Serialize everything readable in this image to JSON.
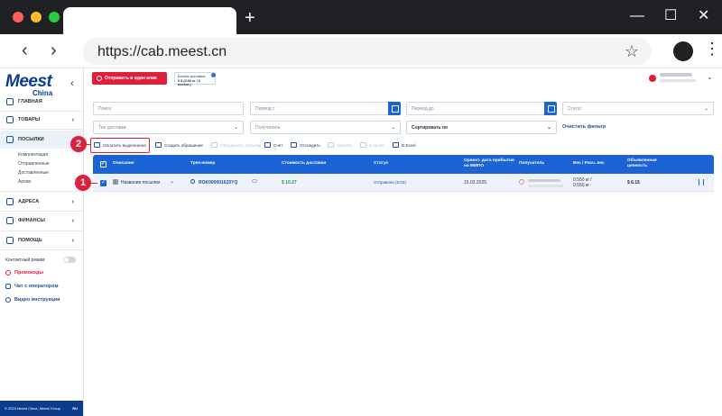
{
  "browser": {
    "url": "https://cab.meest.cn",
    "tab_plus": "+",
    "minimize": "—",
    "maximize": "☐",
    "close": "✕",
    "back": "‹",
    "forward": "›",
    "star": "☆",
    "menu": "⋮",
    "dot_colors": [
      "#ff5f57",
      "#febc2e",
      "#28c840"
    ]
  },
  "logo": {
    "brand": "Meest",
    "sub": "China"
  },
  "sidebar": {
    "collapse": "‹",
    "items": [
      {
        "label": "ГЛАВНАЯ",
        "icon": "home-icon",
        "chevron": ""
      },
      {
        "label": "ТОВАРЫ",
        "icon": "box-icon",
        "chevron": "›"
      },
      {
        "label": "ПОСЫЛКИ",
        "icon": "parcel-icon",
        "chevron": ""
      },
      {
        "label": "АДРЕСА",
        "icon": "location-icon",
        "chevron": "›"
      },
      {
        "label": "ФИНАНСЫ",
        "icon": "wallet-icon",
        "chevron": "›"
      },
      {
        "label": "ПОМОЩЬ",
        "icon": "help-icon",
        "chevron": "›"
      }
    ],
    "sub_items": [
      "Комплектация",
      "Отправленные",
      "Доставленные",
      "Архив"
    ],
    "contact_mode": "Контактный режим",
    "links": [
      {
        "label": "Промокоды",
        "color": "#e01f3d",
        "icon": "promo-icon"
      },
      {
        "label": "Чат с оператором",
        "color": "#1c4fa0",
        "icon": "chat-icon"
      },
      {
        "label": "Видео инструкции",
        "color": "#1c4fa0",
        "icon": "video-icon"
      }
    ],
    "footer": "© 2023 Meest China, Meest Group",
    "lang": "RU"
  },
  "header": {
    "send_button": "Отправить в один клик",
    "balance_label": "Баланс доставки:",
    "balance_value": "0 $ (0.00 кг / 0 посыл.)"
  },
  "filters": {
    "search": "Поиск",
    "period_from": "Период с",
    "period_to": "Период до",
    "status": "Статус",
    "delivery_type": "Тип доставки",
    "recipient": "Получатель",
    "sort": "Сортировать по",
    "clear": "Очистить фильтр"
  },
  "toolbar": {
    "pay_selected": "Оплатить выделенное",
    "create_request": "Создать обращение",
    "merge": "Объединить посылки",
    "invoice": "Счёт",
    "track": "Отследить",
    "delete": "Удалить",
    "archive": "В архив",
    "excel": "В Excel"
  },
  "table": {
    "headers": {
      "description": "Описание",
      "tracking": "Трек-номер",
      "cost": "Стоимость доставки",
      "status": "Статус",
      "arrival_line1": "Ориент. дата прибытия",
      "arrival_line2": "на ММПО",
      "recipient": "Получатель",
      "weight": "Вес / Расч. вес",
      "declared_line1": "Объявленная",
      "declared_line2": "ценность"
    },
    "row": {
      "name": "Название посылки",
      "tracking": "ROK000001620YQ",
      "cost": "$ 10.27",
      "status": "Отправлен (6.02)",
      "arrival": "15.02.2025",
      "weight1": "0.550 кг /",
      "weight2": "0.550 кг",
      "declared": "$ 6.15"
    }
  },
  "markers": {
    "one": "1",
    "two": "2"
  }
}
